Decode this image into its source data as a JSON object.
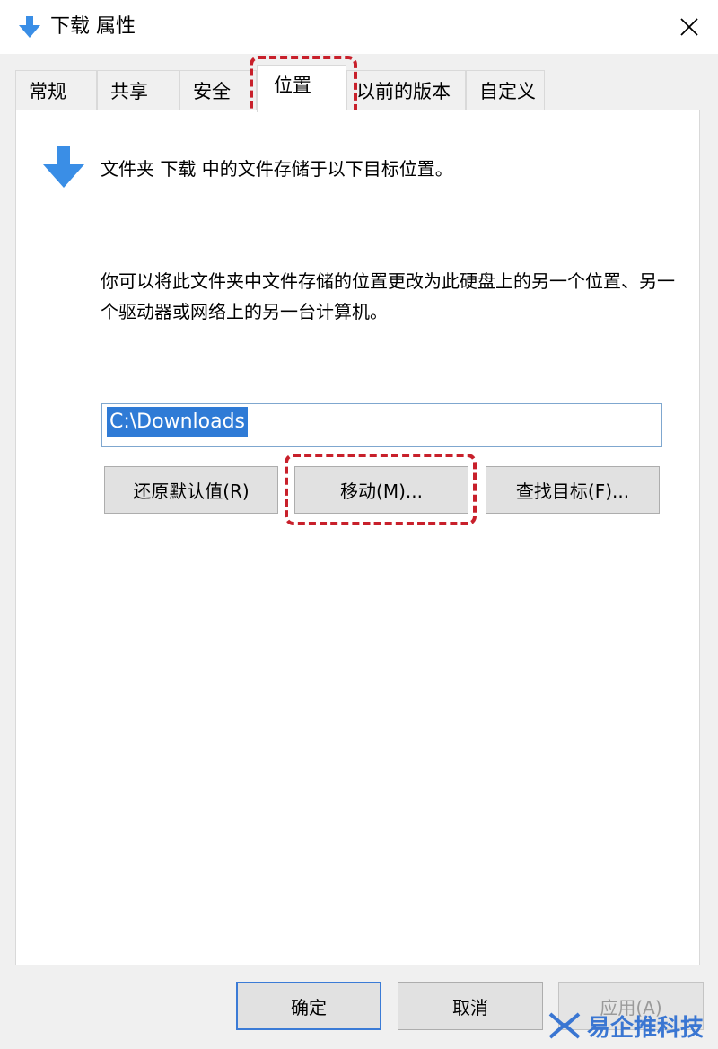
{
  "window": {
    "title": "下载 属性"
  },
  "tabs": [
    {
      "label": "常规"
    },
    {
      "label": "共享"
    },
    {
      "label": "安全"
    },
    {
      "label": "位置"
    },
    {
      "label": "以前的版本"
    },
    {
      "label": "自定义"
    }
  ],
  "location": {
    "heading": "文件夹 下载 中的文件存储于以下目标位置。",
    "description": "你可以将此文件夹中文件存储的位置更改为此硬盘上的另一个位置、另一个驱动器或网络上的另一台计算机。",
    "path_value": "C:\\Downloads",
    "restore_label": "还原默认值(R)",
    "move_label": "移动(M)...",
    "find_label": "查找目标(F)..."
  },
  "footer": {
    "ok_label": "确定",
    "cancel_label": "取消",
    "apply_label": "应用(A)"
  },
  "watermark": {
    "text": "易企推科技"
  },
  "colors": {
    "accent": "#2f7bd6",
    "highlight": "#c8202b",
    "arrow": "#3a8ee6"
  },
  "icons": {
    "title": "download-arrow-icon",
    "close": "close-icon",
    "heading": "download-arrow-icon",
    "watermark": "logo-icon"
  }
}
